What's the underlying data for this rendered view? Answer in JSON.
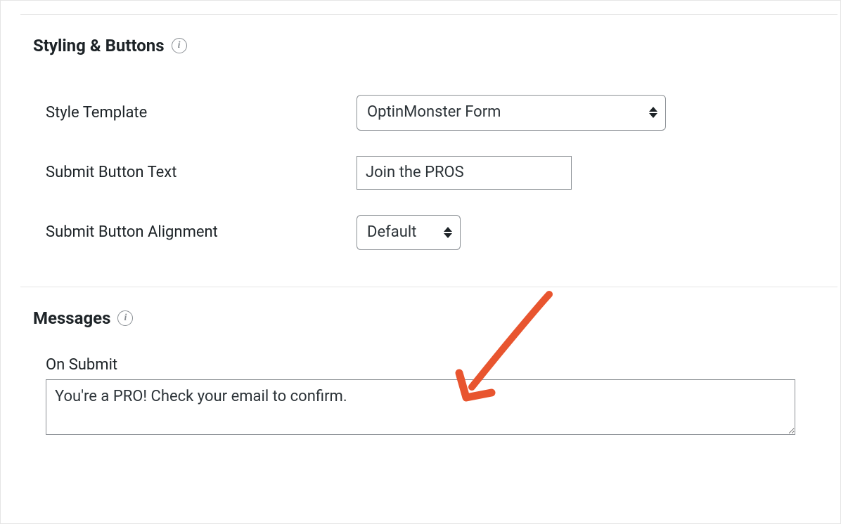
{
  "sections": {
    "styling": {
      "title": "Styling & Buttons",
      "fields": {
        "style_template": {
          "label": "Style Template",
          "value": "OptinMonster Form"
        },
        "submit_button_text": {
          "label": "Submit Button Text",
          "value": "Join the PROS"
        },
        "submit_button_alignment": {
          "label": "Submit Button Alignment",
          "value": "Default"
        }
      }
    },
    "messages": {
      "title": "Messages",
      "fields": {
        "on_submit": {
          "label": "On Submit",
          "value": "You're a PRO! Check your email to confirm."
        }
      }
    }
  },
  "annotation": {
    "color": "#e8552f"
  }
}
